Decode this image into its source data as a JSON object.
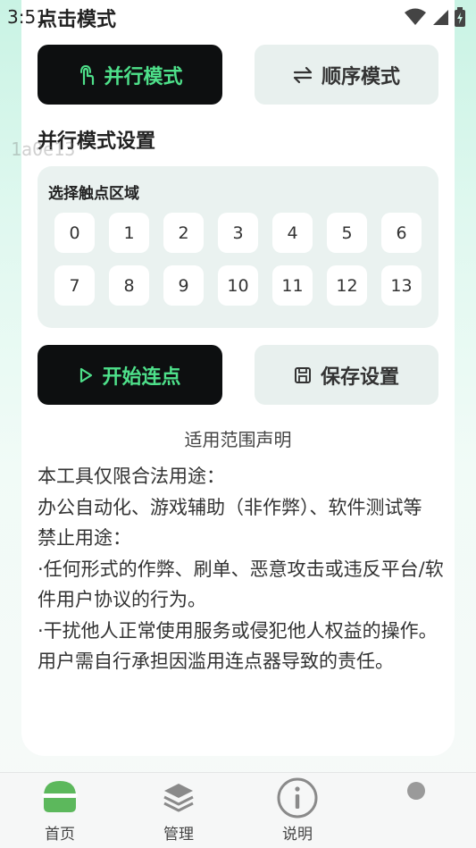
{
  "status_bar": {
    "time": "3:51"
  },
  "header": {
    "title": "点击模式"
  },
  "modes": {
    "parallel_label": "并行模式",
    "sequential_label": "顺序模式"
  },
  "parallel_settings": {
    "title": "并行模式设置",
    "zone_label": "选择触点区域",
    "zones": [
      "0",
      "1",
      "2",
      "3",
      "4",
      "5",
      "6",
      "7",
      "8",
      "9",
      "10",
      "11",
      "12",
      "13"
    ]
  },
  "watermark": "1a0e13",
  "actions": {
    "start_label": "开始连点",
    "save_label": "保存设置"
  },
  "scope": {
    "title": "适用范围声明",
    "lines": [
      "本工具仅限合法用途：",
      "办公自动化、游戏辅助（非作弊）、软件测试等",
      "禁止用途：",
      "·任何形式的作弊、刷单、恶意攻击或违反平台/软件用户协议的行为。",
      "·干扰他人正常使用服务或侵犯他人权益的操作。",
      "用户需自行承担因滥用连点器导致的责任。"
    ]
  },
  "tabs": [
    {
      "label": "首页",
      "icon": "home-icon",
      "active": true
    },
    {
      "label": "管理",
      "icon": "layers-icon",
      "active": false
    },
    {
      "label": "说明",
      "icon": "info-icon",
      "active": false
    },
    {
      "label": "",
      "icon": "dot-icon",
      "active": false
    }
  ],
  "colors": {
    "accent": "#4ee08a",
    "dark_button": "#0d0f10",
    "light_button": "#e8f0ee",
    "tab_active": "#5cb85c"
  }
}
